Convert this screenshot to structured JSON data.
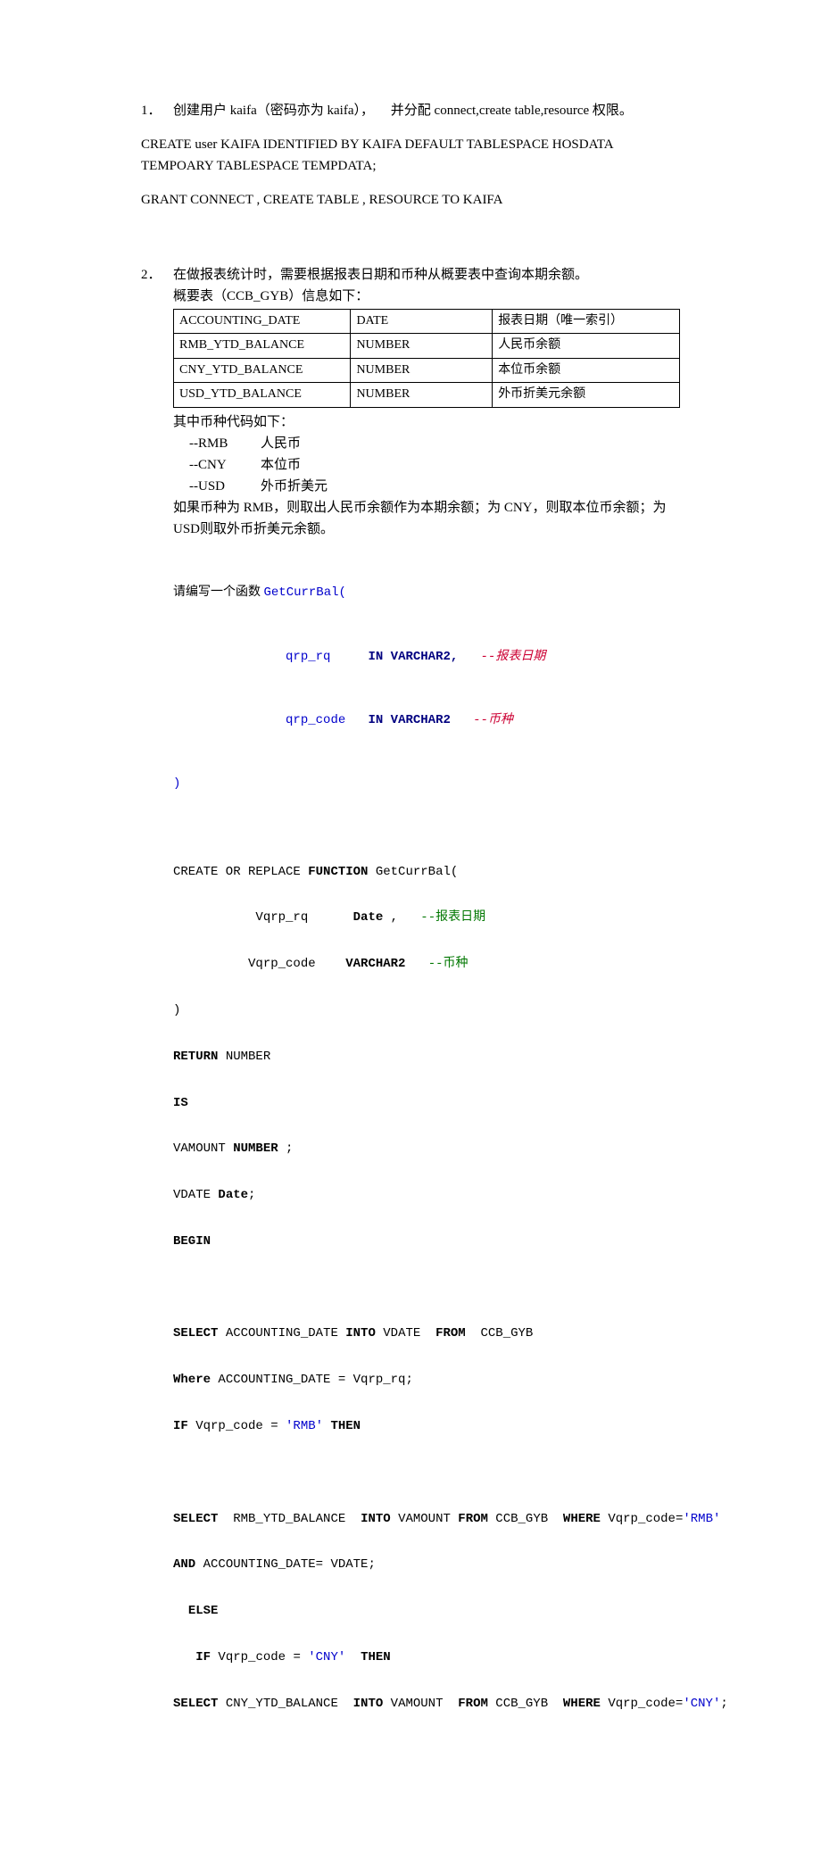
{
  "q1": {
    "marker": "1．",
    "title_zh_pre": "创建用户 ",
    "title_en_user": "kaifa",
    "title_zh_mid": "（密码亦为 ",
    "title_en_pwd": "kaifa",
    "title_zh_after": "），",
    "title_zh_tail_pre": "并分配 ",
    "title_en_priv": "connect,create table,resource ",
    "title_zh_tail": "权限。",
    "sql1": "CREATE user KAIFA IDENTIFIED   BY   KAIFA     DEFAULT TABLESPACE HOSDATA TEMPOARY TABLESPACE TEMPDATA;",
    "sql2": "GRANT CONNECT , CREATE TABLE , RESOURCE TO KAIFA"
  },
  "q2": {
    "marker": "2．",
    "title": "在做报表统计时，需要根据报表日期和币种从概要表中查询本期余额。",
    "intro_pre": "概要表（",
    "intro_en": "CCB_GYB",
    "intro_post": "）信息如下：",
    "table": {
      "rows": [
        [
          "ACCOUNTING_DATE",
          "DATE",
          "报表日期（唯一索引）"
        ],
        [
          "RMB_YTD_BALANCE",
          "NUMBER",
          "人民币余额"
        ],
        [
          "CNY_YTD_BALANCE",
          "NUMBER",
          "本位币余额"
        ],
        [
          "USD_YTD_BALANCE",
          "NUMBER",
          "外币折美元余额"
        ]
      ]
    },
    "currency_intro": "其中币种代码如下：",
    "currency_rows": [
      {
        "code": "--RMB",
        "label": "人民币"
      },
      {
        "code": "--CNY",
        "label": "本位币"
      },
      {
        "code": "--USD",
        "label": "外币折美元"
      }
    ],
    "explain": "如果币种为 RMB，则取出人民币余额作为本期余额；为 CNY，则取本位币余额；为 USD则取外币折美元余额。",
    "write_prefix": "请编写一个函数 ",
    "sig": {
      "name": "GetCurrBal(",
      "line1_arg": "qrp_rq",
      "line1_type": "IN VARCHAR2,",
      "line1_cmt": "--报表日期",
      "line2_arg": "qrp_code",
      "line2_type": "IN VARCHAR2",
      "line2_cmt": "--币种",
      "close": ")"
    },
    "code": {
      "l1_pre": "CREATE OR REPLACE ",
      "l1_kw": "FUNCTION",
      "l1_post": " GetCurrBal(",
      "l2_arg": "Vqrp_rq",
      "l2_type": "Date",
      "l2_comma": " ,",
      "l2_cmt": "--报表日期",
      "l3_arg": "Vqrp_code",
      "l3_type": "VARCHAR2",
      "l3_cmt": "--币种",
      "l4": ")",
      "l5_kw": "RETURN",
      "l5_post": " NUMBER",
      "l6_kw": "IS",
      "l7_pre": "VAMOUNT ",
      "l7_kw": "NUMBER",
      "l7_post": " ;",
      "l8_pre": "VDATE ",
      "l8_kw": "Date",
      "l8_post": ";",
      "l9_kw": "BEGIN",
      "l11_kw1": "SELECT",
      "l11_mid": " ACCOUNTING_DATE ",
      "l11_kw2": "INTO",
      "l11_mid2": " VDATE  ",
      "l11_kw3": "FROM",
      "l11_post": "  CCB_GYB",
      "l12_kw": "Where",
      "l12_post": " ACCOUNTING_DATE = Vqrp_rq;",
      "l13_kw1": "IF",
      "l13_mid": " Vqrp_code = ",
      "l13_str": "'RMB'",
      "l13_kw2": " THEN",
      "l15_kw1": "SELECT",
      "l15_mid": "  RMB_YTD_BALANCE  ",
      "l15_kw2": "INTO",
      "l15_mid2": " VAMOUNT ",
      "l15_kw3": "FROM",
      "l15_mid3": " CCB_GYB  ",
      "l15_kw4": "WHERE",
      "l15_mid4": " Vqrp_code=",
      "l15_str": "'RMB'",
      "l16_kw": "AND",
      "l16_post": " ACCOUNTING_DATE= VDATE;",
      "l17_kw": "ELSE",
      "l18_kw1": "IF",
      "l18_mid": " Vqrp_code = ",
      "l18_str": "'CNY'",
      "l18_kw2": "  THEN",
      "l19_kw1": "SELECT",
      "l19_mid": " CNY_YTD_BALANCE  ",
      "l19_kw2": "INTO",
      "l19_mid2": " VAMOUNT  ",
      "l19_kw3": "FROM",
      "l19_mid3": " CCB_GYB  ",
      "l19_kw4": "WHERE",
      "l19_mid4": " Vqrp_code=",
      "l19_str": "'CNY'",
      "l19_post": ";"
    }
  }
}
